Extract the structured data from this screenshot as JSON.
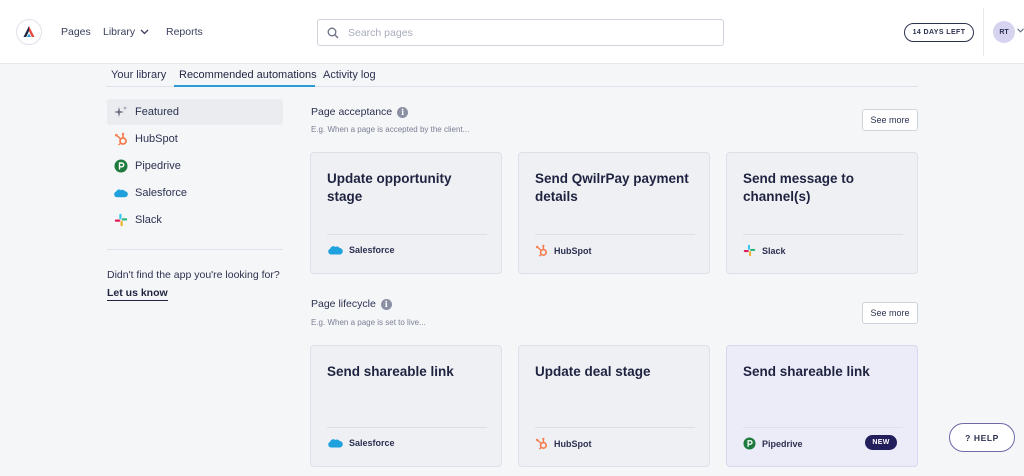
{
  "header": {
    "nav": [
      "Pages",
      "Library",
      "Reports"
    ],
    "search_placeholder": "Search pages",
    "trial_badge": "14 DAYS LEFT",
    "avatar_initials": "RT"
  },
  "tabs": [
    {
      "label": "Your library",
      "active": false
    },
    {
      "label": "Recommended automations",
      "active": true
    },
    {
      "label": "Activity log",
      "active": false
    }
  ],
  "sidebar": {
    "items": [
      {
        "label": "Featured",
        "icon": "sparkle-icon",
        "active": true
      },
      {
        "label": "HubSpot",
        "icon": "hubspot-icon",
        "active": false
      },
      {
        "label": "Pipedrive",
        "icon": "pipedrive-icon",
        "active": false
      },
      {
        "label": "Salesforce",
        "icon": "salesforce-icon",
        "active": false
      },
      {
        "label": "Slack",
        "icon": "slack-icon",
        "active": false
      }
    ],
    "help_text": "Didn't find the app you're looking for?",
    "help_link": "Let us know"
  },
  "sections": [
    {
      "title": "Page acceptance",
      "subtitle": "E.g. When a page is accepted by the client...",
      "see_more": "See more",
      "cards": [
        {
          "title": "Update opportunity stage",
          "app": "Salesforce"
        },
        {
          "title": "Send QwilrPay payment details",
          "app": "HubSpot"
        },
        {
          "title": "Send message to channel(s)",
          "app": "Slack"
        }
      ]
    },
    {
      "title": "Page lifecycle",
      "subtitle": "E.g. When a page is set to live...",
      "see_more": "See more",
      "cards": [
        {
          "title": "Send shareable link",
          "app": "Salesforce"
        },
        {
          "title": "Update deal stage",
          "app": "HubSpot"
        },
        {
          "title": "Send shareable link",
          "app": "Pipedrive",
          "badge": "NEW"
        }
      ]
    }
  ],
  "help_button": "? HELP",
  "colors": {
    "accent": "#2e9bd6",
    "hubspot": "#f57d4f",
    "pipedrive": "#1f7a3d",
    "salesforce": "#1ea1dc",
    "new_badge": "#231f5c"
  }
}
